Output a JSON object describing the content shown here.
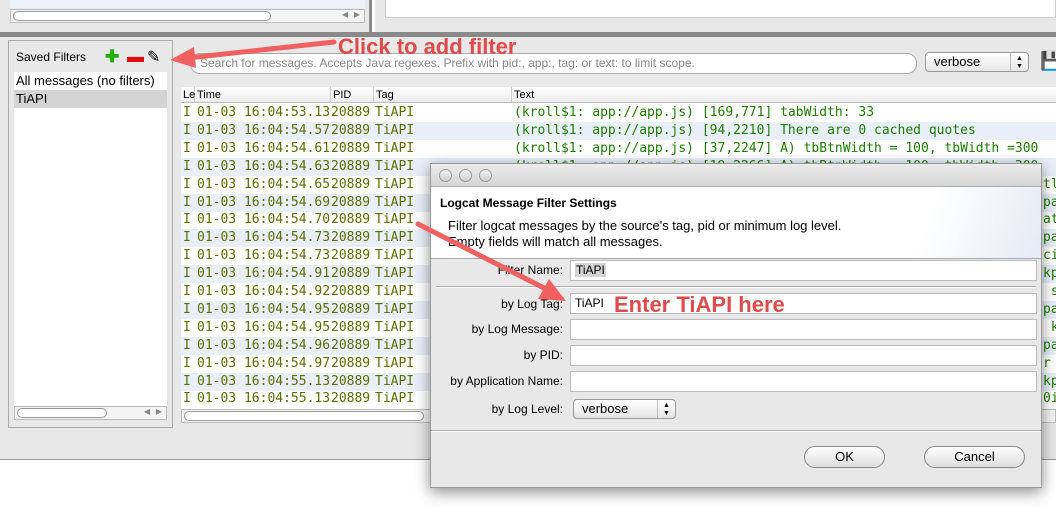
{
  "saved_filters": {
    "title": "Saved Filters",
    "add_icon": "plus-icon",
    "remove_icon": "minus-icon",
    "edit_icon": "edit-icon",
    "items": [
      "All messages (no filters)",
      "TiAPI"
    ],
    "selected": "TiAPI"
  },
  "search": {
    "placeholder": "Search for messages. Accepts Java regexes. Prefix with pid:, app:, tag: or text: to limit scope."
  },
  "log_level_select": {
    "value": "verbose"
  },
  "save_icon": "floppy-disk-icon",
  "table": {
    "columns": [
      "Le",
      "Time",
      "PID",
      "Tag",
      "Text"
    ],
    "rows": [
      {
        "level": "I",
        "time": "01-03 16:04:53.13",
        "pid": "20889",
        "tag": "TiAPI",
        "text": "(kroll$1: app://app.js) [169,771] tabWidth: 33"
      },
      {
        "level": "I",
        "time": "01-03 16:04:54.57",
        "pid": "20889",
        "tag": "TiAPI",
        "text": "(kroll$1: app://app.js) [94,2210] There are 0 cached quotes"
      },
      {
        "level": "I",
        "time": "01-03 16:04:54.61",
        "pid": "20889",
        "tag": "TiAPI",
        "text": "(kroll$1: app://app.js) [37,2247] A) tbBtnWidth = 100, tbWidth =300"
      },
      {
        "level": "I",
        "time": "01-03 16:04:54.63",
        "pid": "20889",
        "tag": "TiAPI",
        "text": "(kroll$1: app://app.js) [19,2266] A) tbBtnWidth = 100, tbWidth =300"
      },
      {
        "level": "I",
        "time": "01-03 16:04:54.65",
        "pid": "20889",
        "tag": "TiAPI",
        "text": "tl"
      },
      {
        "level": "I",
        "time": "01-03 16:04:54.69",
        "pid": "20889",
        "tag": "TiAPI",
        "text": "pa"
      },
      {
        "level": "I",
        "time": "01-03 16:04:54.70",
        "pid": "20889",
        "tag": "TiAPI",
        "text": "at"
      },
      {
        "level": "I",
        "time": "01-03 16:04:54.73",
        "pid": "20889",
        "tag": "TiAPI",
        "text": "pa"
      },
      {
        "level": "I",
        "time": "01-03 16:04:54.73",
        "pid": "20889",
        "tag": "TiAPI",
        "text": "ci"
      },
      {
        "level": "I",
        "time": "01-03 16:04:54.91",
        "pid": "20889",
        "tag": "TiAPI",
        "text": "kp"
      },
      {
        "level": "I",
        "time": "01-03 16:04:54.92",
        "pid": "20889",
        "tag": "TiAPI",
        "text": " s"
      },
      {
        "level": "I",
        "time": "01-03 16:04:54.95",
        "pid": "20889",
        "tag": "TiAPI",
        "text": "pa"
      },
      {
        "level": "I",
        "time": "01-03 16:04:54.95",
        "pid": "20889",
        "tag": "TiAPI",
        "text": " k"
      },
      {
        "level": "I",
        "time": "01-03 16:04:54.96",
        "pid": "20889",
        "tag": "TiAPI",
        "text": "pa"
      },
      {
        "level": "I",
        "time": "01-03 16:04:54.97",
        "pid": "20889",
        "tag": "TiAPI",
        "text": "r"
      },
      {
        "level": "I",
        "time": "01-03 16:04:55.13",
        "pid": "20889",
        "tag": "TiAPI",
        "text": "kp"
      },
      {
        "level": "I",
        "time": "01-03 16:04:55.13",
        "pid": "20889",
        "tag": "TiAPI",
        "text": "0i"
      }
    ]
  },
  "dialog": {
    "title": "Logcat Message Filter Settings",
    "description_line1": "Filter logcat messages by the source's tag, pid or minimum log level.",
    "description_line2": "Empty fields will match all messages.",
    "filter_name_label": "Filter Name:",
    "filter_name_value": "TiAPI",
    "log_tag_label": "by Log Tag:",
    "log_tag_value": "TiAPI",
    "log_message_label": "by Log Message:",
    "log_message_value": "",
    "pid_label": "by PID:",
    "pid_value": "",
    "app_name_label": "by Application Name:",
    "app_name_value": "",
    "log_level_label": "by Log Level:",
    "log_level_value": "verbose",
    "ok_label": "OK",
    "cancel_label": "Cancel"
  },
  "annotations": {
    "add_filter": "Click to add filter",
    "enter_tag": "Enter TiAPI here",
    "color": "#e04a4a"
  }
}
